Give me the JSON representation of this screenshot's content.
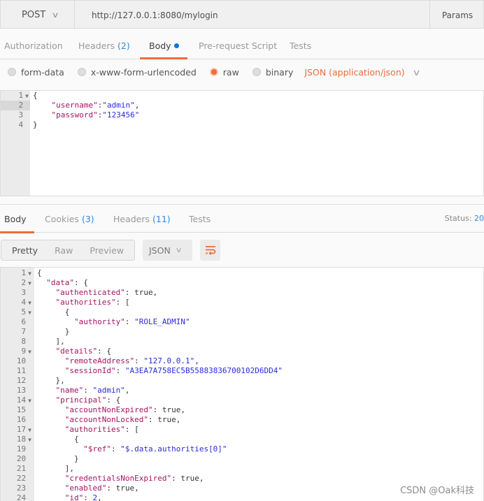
{
  "request": {
    "method": "POST",
    "url": "http://127.0.0.1:8080/mylogin",
    "params_label": "Params",
    "tabs": [
      {
        "label": "Authorization"
      },
      {
        "label": "Headers",
        "count": "(2)"
      },
      {
        "label": "Body",
        "active": true,
        "modified": true
      },
      {
        "label": "Pre-request Script"
      },
      {
        "label": "Tests"
      }
    ],
    "body_modes": [
      {
        "label": "form-data",
        "selected": false
      },
      {
        "label": "x-www-form-urlencoded",
        "selected": false
      },
      {
        "label": "raw",
        "selected": true
      },
      {
        "label": "binary",
        "selected": false
      }
    ],
    "content_type": "JSON (application/json)",
    "highlighted_line": 2,
    "body_lines": [
      {
        "fold": true,
        "tokens": [
          [
            "p",
            "{"
          ]
        ]
      },
      {
        "tokens": [
          [
            "p",
            "    "
          ],
          [
            "k",
            "\"username\""
          ],
          [
            "p",
            ":"
          ],
          [
            "s",
            "\"admin\""
          ],
          [
            "p",
            ","
          ]
        ]
      },
      {
        "tokens": [
          [
            "p",
            "    "
          ],
          [
            "k",
            "\"password\""
          ],
          [
            "p",
            ":"
          ],
          [
            "s",
            "\"123456\""
          ]
        ]
      },
      {
        "tokens": [
          [
            "p",
            "}"
          ]
        ]
      }
    ]
  },
  "response": {
    "tabs": [
      {
        "label": "Body",
        "active": true
      },
      {
        "label": "Cookies",
        "count": "(3)"
      },
      {
        "label": "Headers",
        "count": "(11)"
      },
      {
        "label": "Tests"
      }
    ],
    "status_label": "Status:",
    "status_value": "20",
    "view_modes": [
      {
        "label": "Pretty",
        "selected": true
      },
      {
        "label": "Raw"
      },
      {
        "label": "Preview"
      }
    ],
    "format": "JSON",
    "accent_color": "#f26b3a",
    "body_lines": [
      {
        "fold": true,
        "tokens": [
          [
            "p",
            "{"
          ]
        ]
      },
      {
        "fold": true,
        "tokens": [
          [
            "p",
            "  "
          ],
          [
            "k",
            "\"data\""
          ],
          [
            "p",
            ": {"
          ]
        ]
      },
      {
        "tokens": [
          [
            "p",
            "    "
          ],
          [
            "k",
            "\"authenticated\""
          ],
          [
            "p",
            ": "
          ],
          [
            "v",
            "true"
          ],
          [
            "p",
            ","
          ]
        ]
      },
      {
        "fold": true,
        "tokens": [
          [
            "p",
            "    "
          ],
          [
            "k",
            "\"authorities\""
          ],
          [
            "p",
            ": ["
          ]
        ]
      },
      {
        "fold": true,
        "tokens": [
          [
            "p",
            "      {"
          ]
        ]
      },
      {
        "tokens": [
          [
            "p",
            "        "
          ],
          [
            "k",
            "\"authority\""
          ],
          [
            "p",
            ": "
          ],
          [
            "s",
            "\"ROLE_ADMIN\""
          ]
        ]
      },
      {
        "tokens": [
          [
            "p",
            "      }"
          ]
        ]
      },
      {
        "tokens": [
          [
            "p",
            "    ],"
          ]
        ]
      },
      {
        "fold": true,
        "tokens": [
          [
            "p",
            "    "
          ],
          [
            "k",
            "\"details\""
          ],
          [
            "p",
            ": {"
          ]
        ]
      },
      {
        "tokens": [
          [
            "p",
            "      "
          ],
          [
            "k",
            "\"remoteAddress\""
          ],
          [
            "p",
            ": "
          ],
          [
            "s",
            "\"127.0.0.1\""
          ],
          [
            "p",
            ","
          ]
        ]
      },
      {
        "tokens": [
          [
            "p",
            "      "
          ],
          [
            "k",
            "\"sessionId\""
          ],
          [
            "p",
            ": "
          ],
          [
            "s",
            "\"A3EA7A758EC5B55883836700102D6DD4\""
          ]
        ]
      },
      {
        "tokens": [
          [
            "p",
            "    },"
          ]
        ]
      },
      {
        "tokens": [
          [
            "p",
            "    "
          ],
          [
            "k",
            "\"name\""
          ],
          [
            "p",
            ": "
          ],
          [
            "s",
            "\"admin\""
          ],
          [
            "p",
            ","
          ]
        ]
      },
      {
        "fold": true,
        "tokens": [
          [
            "p",
            "    "
          ],
          [
            "k",
            "\"principal\""
          ],
          [
            "p",
            ": {"
          ]
        ]
      },
      {
        "tokens": [
          [
            "p",
            "      "
          ],
          [
            "k",
            "\"accountNonExpired\""
          ],
          [
            "p",
            ": "
          ],
          [
            "v",
            "true"
          ],
          [
            "p",
            ","
          ]
        ]
      },
      {
        "tokens": [
          [
            "p",
            "      "
          ],
          [
            "k",
            "\"accountNonLocked\""
          ],
          [
            "p",
            ": "
          ],
          [
            "v",
            "true"
          ],
          [
            "p",
            ","
          ]
        ]
      },
      {
        "fold": true,
        "tokens": [
          [
            "p",
            "      "
          ],
          [
            "k",
            "\"authorities\""
          ],
          [
            "p",
            ": ["
          ]
        ]
      },
      {
        "fold": true,
        "tokens": [
          [
            "p",
            "        {"
          ]
        ]
      },
      {
        "tokens": [
          [
            "p",
            "          "
          ],
          [
            "k",
            "\"$ref\""
          ],
          [
            "p",
            ": "
          ],
          [
            "s",
            "\"$.data.authorities[0]\""
          ]
        ]
      },
      {
        "tokens": [
          [
            "p",
            "        }"
          ]
        ]
      },
      {
        "tokens": [
          [
            "p",
            "      ],"
          ]
        ]
      },
      {
        "tokens": [
          [
            "p",
            "      "
          ],
          [
            "k",
            "\"credentialsNonExpired\""
          ],
          [
            "p",
            ": "
          ],
          [
            "v",
            "true"
          ],
          [
            "p",
            ","
          ]
        ]
      },
      {
        "tokens": [
          [
            "p",
            "      "
          ],
          [
            "k",
            "\"enabled\""
          ],
          [
            "p",
            ": "
          ],
          [
            "v",
            "true"
          ],
          [
            "p",
            ","
          ]
        ]
      },
      {
        "tokens": [
          [
            "p",
            "      "
          ],
          [
            "k",
            "\"id\""
          ],
          [
            "p",
            ": "
          ],
          [
            "s",
            "2"
          ],
          [
            "p",
            ","
          ]
        ]
      }
    ]
  },
  "watermark": "CSDN @Oak科技"
}
